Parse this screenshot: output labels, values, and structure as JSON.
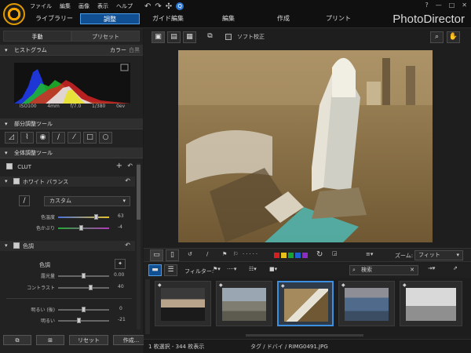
{
  "menu": [
    "ファイル",
    "編集",
    "画像",
    "表示",
    "ヘルプ"
  ],
  "nav": {
    "library": "ライブラリー",
    "adjust": "調整",
    "guided": "ガイド編集",
    "edit": "編集",
    "create": "作成",
    "print": "プリント"
  },
  "brand": "PhotoDirector",
  "window": {
    "help": "?",
    "minimize": "—",
    "maximize": "□",
    "close": "✕"
  },
  "subtabs": {
    "manual": "手動",
    "presets": "プリセット"
  },
  "histogram": {
    "title": "ヒストグラム",
    "color": "カラー",
    "mono": "白黒",
    "iso": "ISO100",
    "focal": "4mm",
    "fstop": "f/7.0",
    "shutter": "1/380",
    "ev": "0ev"
  },
  "local_tools": {
    "title": "部分調整ツール",
    "tools": [
      "◿",
      "⌇",
      "◉",
      "∕",
      "⁄",
      "□",
      "○"
    ]
  },
  "global_tools": {
    "title": "全体調整ツール"
  },
  "clut": {
    "label": "CLUT"
  },
  "white_balance": {
    "label": "ホワイト バランス",
    "preset": "カスタム",
    "temp_label": "色温度",
    "temp_value": "63",
    "tint_label": "色かぶり",
    "tint_value": "-4",
    "temp_pos": 0.76,
    "tint_pos": 0.45
  },
  "tone": {
    "label": "色調",
    "sub": "色調",
    "exposure_label": "露光量",
    "exposure_value": "0.00",
    "contrast_label": "コントラスト",
    "contrast_value": "40",
    "highlights_label": "明るい (後)",
    "highlights_value": "0",
    "brightness_label": "明るい",
    "brightness_value": "-21",
    "exposure_pos": 0.5,
    "contrast_pos": 0.65,
    "highlights_pos": 0.5,
    "brightness_pos": 0.4
  },
  "bottom": {
    "reset": "リセット",
    "create": "作成..."
  },
  "toolbar": {
    "soft_proof": "ソフト校正"
  },
  "filmstrip": {
    "zoom_label": "ズーム:",
    "zoom_value": "フィット",
    "filter_label": "フィルター:",
    "search_placeholder": "検索",
    "status": "1 枚選択 - 344 枚表示",
    "path": "タグ / ドバイ / RIMG0491.JPG"
  },
  "colors": {
    "accent": "#3d8fe0",
    "active_tab": "#0f4f92",
    "red_label": "#d42020",
    "yellow_label": "#e6c11c",
    "green_label": "#19a332",
    "blue_label": "#1f5fd2",
    "purple_label": "#8d2cc6"
  }
}
